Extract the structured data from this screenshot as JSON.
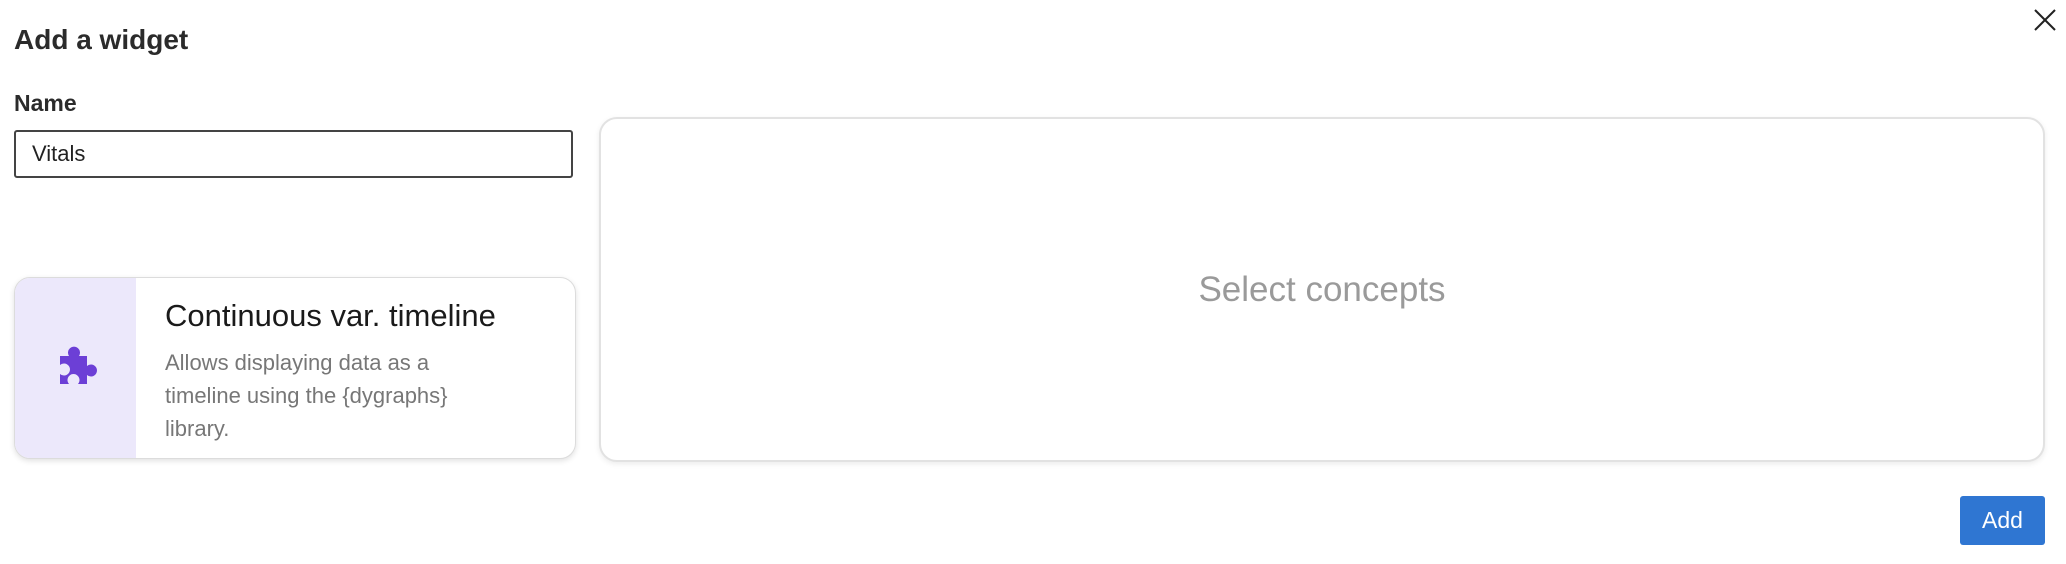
{
  "dialog": {
    "title": "Add a widget",
    "close_icon": "close-icon"
  },
  "form": {
    "name_label": "Name",
    "name_value": "Vitals"
  },
  "widget_card": {
    "icon": "puzzle-piece-icon",
    "icon_color": "#6c3fd6",
    "icon_background": "#ece8fb",
    "title": "Continuous var. timeline",
    "description": "Allows displaying data as a timeline using the {dygraphs} library."
  },
  "concepts_panel": {
    "placeholder": "Select concepts"
  },
  "actions": {
    "add_label": "Add",
    "add_color": "#2f76d2"
  }
}
